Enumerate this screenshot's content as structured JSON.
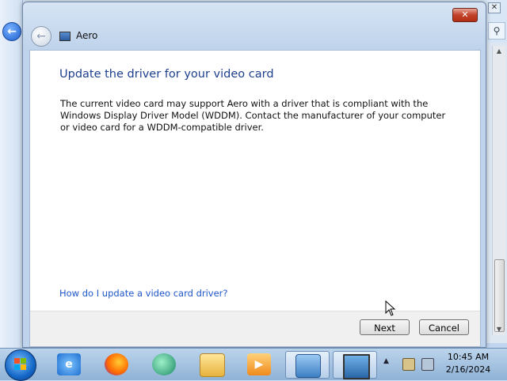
{
  "background_window": {
    "back_icon": "back-arrow-icon",
    "close_glyph": "✕",
    "search_icon": "search-icon"
  },
  "dialog": {
    "title": "Aero",
    "close_glyph": "✕",
    "heading": "Update the driver for your video card",
    "body": "The current video card may support Aero with a driver that is compliant with the Windows Display Driver Model (WDDM).  Contact the manufacturer of your computer or video card for a WDDM-compatible driver.",
    "help_link": "How do I update a video card driver?",
    "next_label": "Next",
    "cancel_label": "Cancel"
  },
  "taskbar": {
    "pinned": [
      {
        "name": "internet-explorer-icon"
      },
      {
        "name": "firefox-icon"
      },
      {
        "name": "app-icon"
      },
      {
        "name": "file-explorer-icon"
      },
      {
        "name": "media-player-icon"
      },
      {
        "name": "control-panel-icon"
      },
      {
        "name": "display-settings-icon"
      }
    ],
    "clock_time": "10:45 AM",
    "clock_date": "2/16/2024"
  },
  "colors": {
    "heading": "#1e3f8f",
    "link": "#1f57c8",
    "close_button": "#c2412a"
  }
}
